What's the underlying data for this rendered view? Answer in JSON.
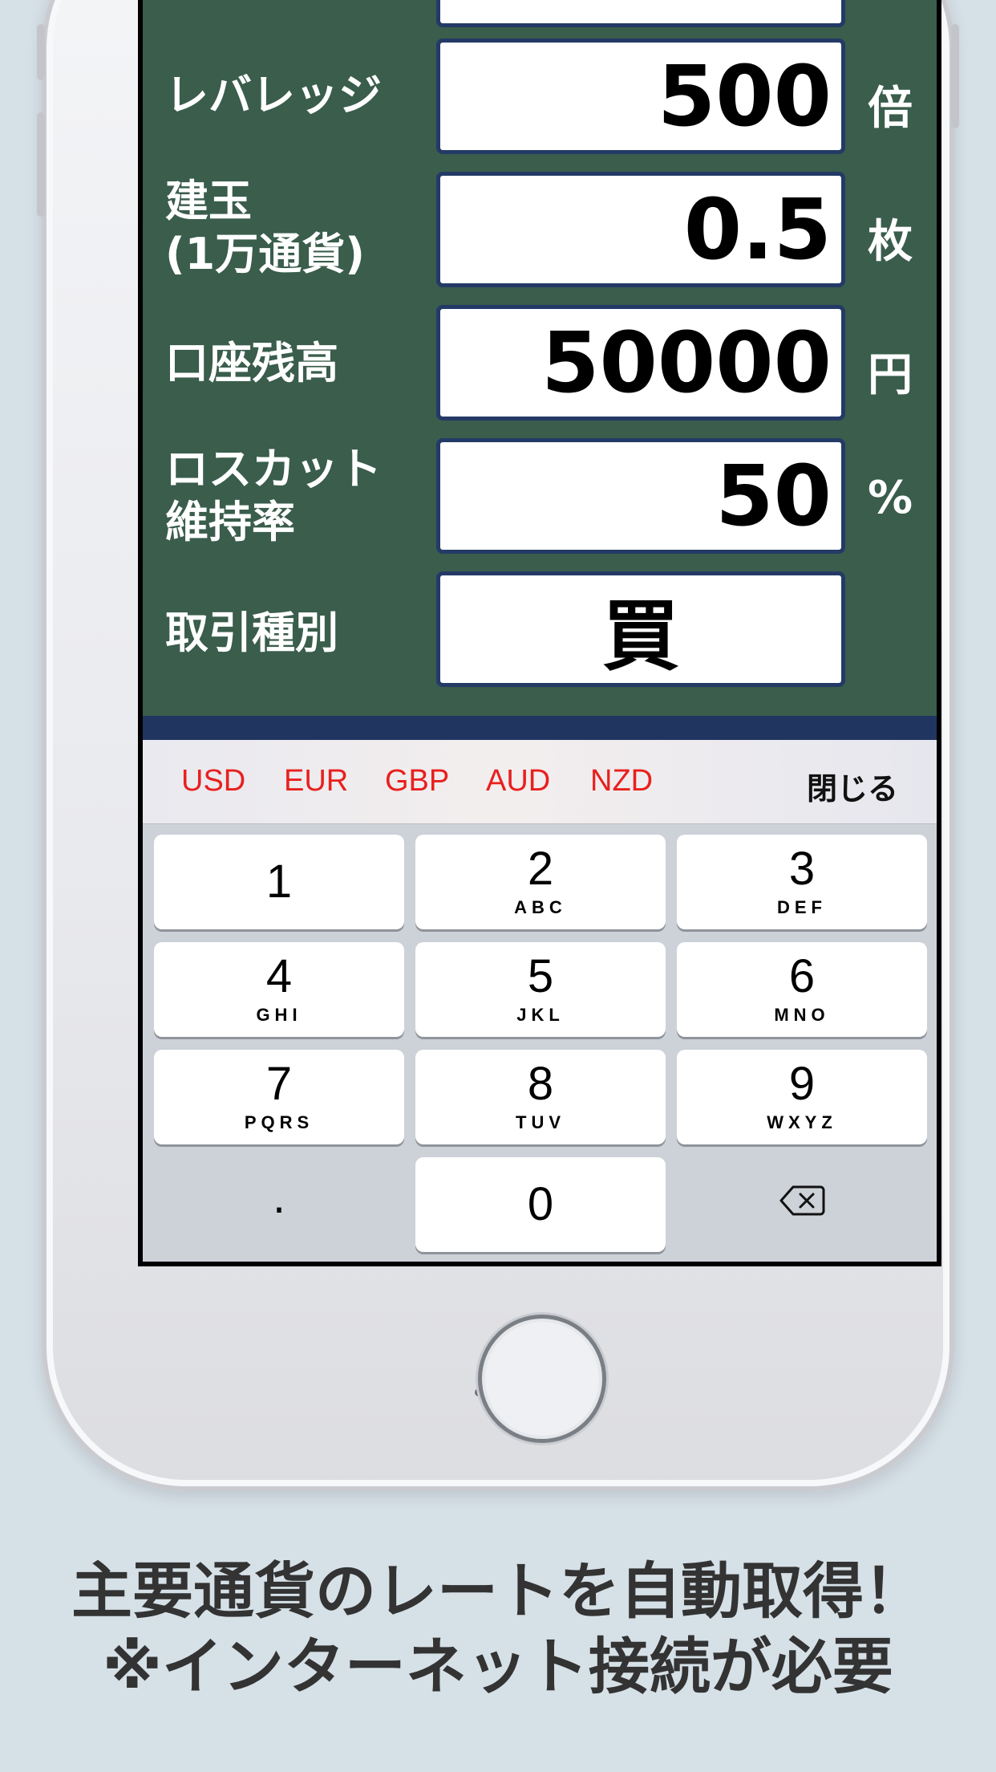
{
  "form": {
    "leverage": {
      "label": "レバレッジ",
      "value": "500",
      "unit": "倍"
    },
    "position": {
      "label": "建玉\n(1万通貨)",
      "value": "0.5",
      "unit": "枚"
    },
    "balance": {
      "label": "口座残高",
      "value": "50000",
      "unit": "円"
    },
    "losscut": {
      "label": "ロスカット\n維持率",
      "value": "50",
      "unit": "%"
    },
    "trade_type": {
      "label": "取引種別",
      "value": "買"
    }
  },
  "accessory": {
    "currencies": [
      "USD",
      "EUR",
      "GBP",
      "AUD",
      "NZD"
    ],
    "close_label": "閉じる"
  },
  "keypad": {
    "keys": [
      {
        "num": "1",
        "letters": ""
      },
      {
        "num": "2",
        "letters": "ABC"
      },
      {
        "num": "3",
        "letters": "DEF"
      },
      {
        "num": "4",
        "letters": "GHI"
      },
      {
        "num": "5",
        "letters": "JKL"
      },
      {
        "num": "6",
        "letters": "MNO"
      },
      {
        "num": "7",
        "letters": "PQRS"
      },
      {
        "num": "8",
        "letters": "TUV"
      },
      {
        "num": "9",
        "letters": "WXYZ"
      }
    ],
    "dot": ".",
    "zero": "0"
  },
  "caption": {
    "line1": "主要通貨のレートを自動取得！",
    "line2": "※インターネット接続が必要"
  },
  "colors": {
    "screen_bg": "#3a5d4c",
    "field_border": "#243a66",
    "currency_text": "#e8201e"
  }
}
